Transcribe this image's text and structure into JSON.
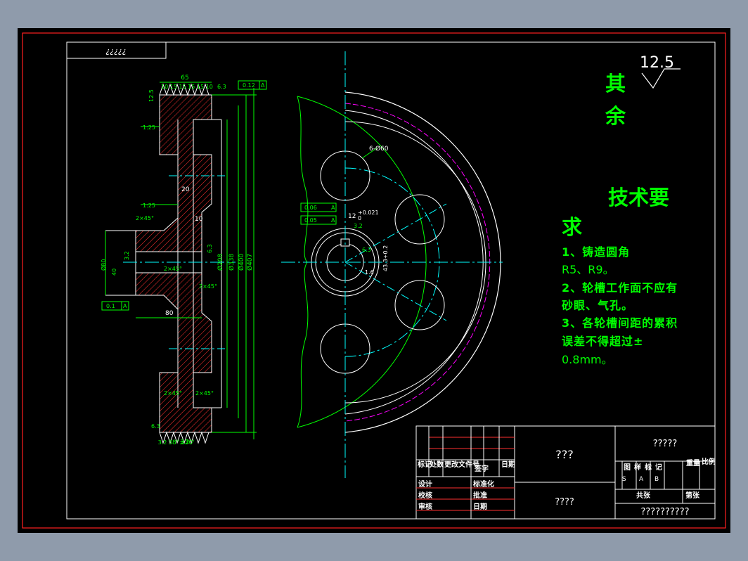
{
  "title_tag": "¿¿¿¿¿",
  "roughness": {
    "label": "其余",
    "label_top": "其",
    "label_bottom": "余",
    "value": "12.5"
  },
  "tech_req": {
    "heading": "技术要求",
    "heading_a": "技术要",
    "heading_b": "求",
    "lines": [
      "1、铸造圆角",
      "R5、R9。",
      "2、轮槽工作面不应有",
      "砂眼、气孔。",
      "3、各轮槽间距的累积",
      "误差不得超过±",
      "0.8mm。"
    ]
  },
  "dims": {
    "top_width": "65",
    "groove_pitch": "10 15 15 15 15 10",
    "groove_depth": "12.5",
    "top_gap": "6.3",
    "runout_top": "0.12",
    "runout_top_ref": "A",
    "taper_1": "1:25",
    "taper_2": "1:25",
    "chamfer_1": "2×45°",
    "chamfer_2": "2×45°",
    "chamfer_3": "2×45°",
    "chamfer_4": "2×45°",
    "chamfer_5": "2×45°",
    "rib": "20",
    "web": "10",
    "hub_len": "80",
    "bore": "Ø80",
    "bore_fit": "40",
    "rough_bore": "3.2",
    "rough_face": "6.3",
    "dia_208": "Ø208",
    "dia_338": "Ø338",
    "dia_400": "Ø400",
    "dia_407": "Ø407",
    "runout_side": "0.1",
    "runout_side_ref": "A",
    "groove_angle": "38°±30'",
    "groove_rough": "3.2",
    "groove_rough2": "3.2",
    "rim_rough": "6.3",
    "holes": "6-Ø60",
    "parallel_val": "0.06",
    "parallel_ref": "A",
    "sym_val": "0.05",
    "sym_ref": "A",
    "key_w": "12",
    "key_tol": "+0.021",
    "key_tol2": "0",
    "key_rough": "3.2",
    "key_r": "6.3",
    "key_depth": "43.3+0.2",
    "key_r2": "1.6"
  },
  "title_block": {
    "part_name": "???",
    "material": "????",
    "company": "?????",
    "drawing_no": "??????????",
    "h_mark": "标记",
    "h_count": "处数",
    "h_doc": "更改文件号",
    "h_sign": "签字",
    "h_date": "日期",
    "r_design": "设计",
    "r_check": "校核",
    "r_audit": "审核",
    "r_std": "标准化",
    "r_approve": "批准",
    "r_date": "日期",
    "stage": "图样标记",
    "weight": "重量",
    "scale": "比例",
    "s_label": "S",
    "a_label": "A",
    "b_label": "B",
    "sheets_total": "共张",
    "sheet_no": "第张"
  },
  "colors": {
    "frame": "#ff2020",
    "outline": "#ffffff",
    "center": "#00ffff",
    "dim": "#00ff00",
    "hatch": "#ff3030",
    "phantom": "#ff00ff",
    "canvas": "#000000"
  }
}
